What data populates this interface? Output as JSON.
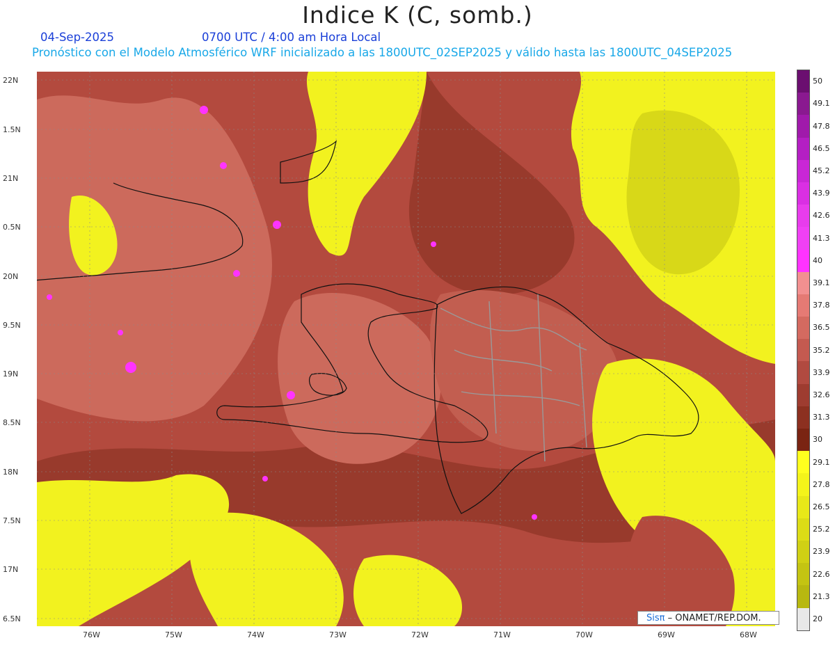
{
  "title": "Indice K (C, somb.)",
  "date_line": "04-Sep-2025",
  "time_line": "0700 UTC / 4:00 am Hora Local",
  "forecast_line": "Pronóstico con el Modelo Atmosférico WRF inicializado a las 1800UTC_02SEP2025 y válido hasta las  1800UTC_04SEP2025",
  "lat_labels": [
    "22N",
    "1.5N",
    "21N",
    "0.5N",
    "20N",
    "9.5N",
    "19N",
    "8.5N",
    "18N",
    "7.5N",
    "17N",
    "6.5N"
  ],
  "lon_labels": [
    "76W",
    "75W",
    "74W",
    "73W",
    "72W",
    "71W",
    "70W",
    "69W",
    "68W"
  ],
  "colorbar": {
    "labels": [
      "50",
      "49.1",
      "47.8",
      "46.5",
      "45.2",
      "43.9",
      "42.6",
      "41.3",
      "40",
      "39.1",
      "37.8",
      "36.5",
      "35.2",
      "33.9",
      "32.6",
      "31.3",
      "30",
      "29.1",
      "27.8",
      "26.5",
      "25.2",
      "23.9",
      "22.6",
      "21.3",
      "20"
    ],
    "colors": [
      "#6b0f70",
      "#8a1990",
      "#a01aab",
      "#b41fc3",
      "#c927d6",
      "#da2fe3",
      "#e83cec",
      "#f040f4",
      "#ff33ff",
      "#f29090",
      "#e57a74",
      "#d46a60",
      "#c45a50",
      "#b14a40",
      "#9e3c30",
      "#8c3020",
      "#7a2412",
      "#ffff1e",
      "#f4f41a",
      "#e8e818",
      "#dcdc16",
      "#d0d014",
      "#c4c412",
      "#b8b810",
      "#e8e8e8"
    ]
  },
  "logo": {
    "brand": "Sisπ",
    "text": " – ONAMET/REP.DOM."
  },
  "colors": {
    "hot": "#b34a3e",
    "warm": "#cc6a5c",
    "cool": "#f2f21f",
    "cold": "#d8d818",
    "dark": "#8e3324",
    "peak": "#ff33ff"
  }
}
